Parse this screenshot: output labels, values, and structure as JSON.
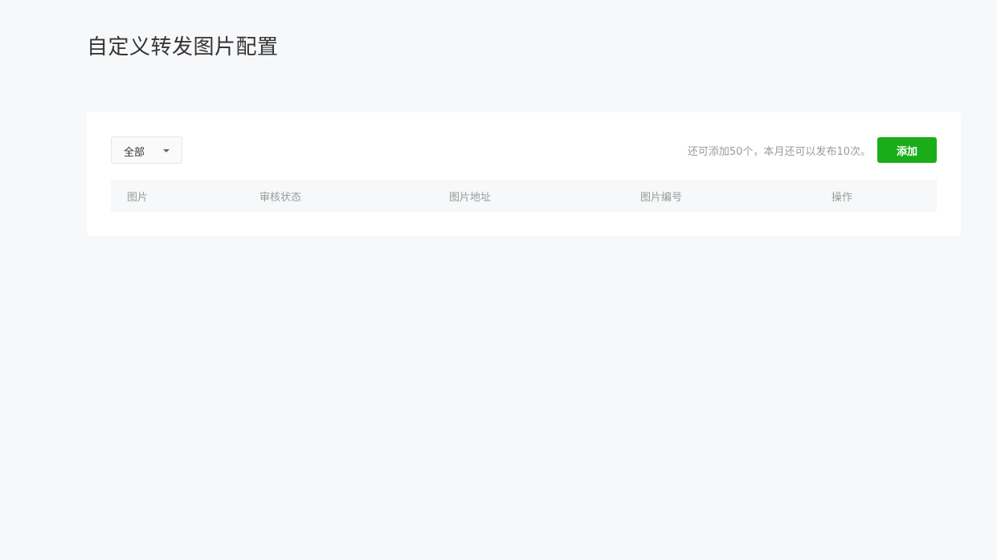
{
  "page": {
    "title": "自定义转发图片配置"
  },
  "filter": {
    "selected": "全部"
  },
  "toolbar": {
    "quota_text": "还可添加50个，本月还可以发布10次。",
    "add_label": "添加"
  },
  "table": {
    "columns": [
      "图片",
      "审核状态",
      "图片地址",
      "图片编号",
      "操作"
    ]
  },
  "colors": {
    "accent": "#1aad19",
    "background": "#f7f8fa",
    "card": "#ffffff",
    "header_row": "#f6f8f9",
    "muted_text": "#9a9a9a"
  },
  "icons": {
    "dropdown": "chevron-down-icon"
  }
}
